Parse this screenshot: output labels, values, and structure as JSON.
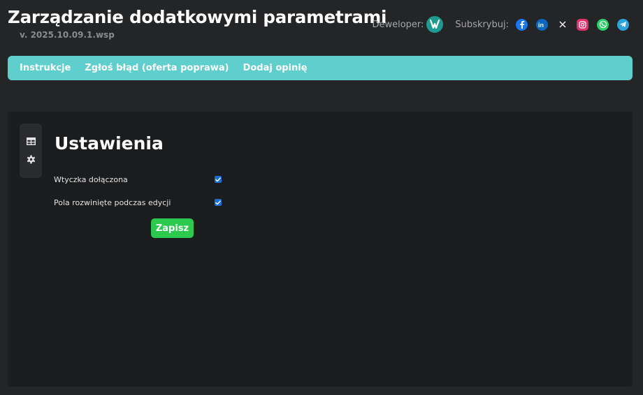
{
  "header": {
    "title": "Zarządzanie dodatkowymi parametrami",
    "version": "v. 2025.10.09.1.wsp",
    "developer_label": "Deweloper:",
    "developer_logo_icon": "developer-logo-icon",
    "subscribe_label": "Subskrybuj:",
    "social": [
      {
        "name": "facebook",
        "icon": "facebook-icon",
        "color": "#1877f2"
      },
      {
        "name": "linkedin",
        "icon": "linkedin-icon",
        "color": "#0a66c2"
      },
      {
        "name": "x",
        "icon": "x-icon",
        "color": "#ffffff"
      },
      {
        "name": "instagram",
        "icon": "instagram-icon",
        "color": "#e1306c"
      },
      {
        "name": "whatsapp",
        "icon": "whatsapp-icon",
        "color": "#25d366"
      },
      {
        "name": "telegram",
        "icon": "telegram-icon",
        "color": "#2aa3df"
      }
    ]
  },
  "nav": {
    "items": [
      {
        "label": "Instrukcje"
      },
      {
        "label": "Zgłoś błąd (oferta poprawa)"
      },
      {
        "label": "Dodaj opinię"
      }
    ],
    "color": "#5ecfcc"
  },
  "sidebar": {
    "buttons": [
      {
        "icon": "table-icon"
      },
      {
        "icon": "gear-icon"
      }
    ]
  },
  "settings": {
    "title": "Ustawienia",
    "options": [
      {
        "label": "Wtyczka dołączona",
        "checked": true
      },
      {
        "label": "Pola rozwinięte podczas edycji",
        "checked": true
      }
    ],
    "save_label": "Zapisz",
    "save_color": "#2bc94e"
  }
}
